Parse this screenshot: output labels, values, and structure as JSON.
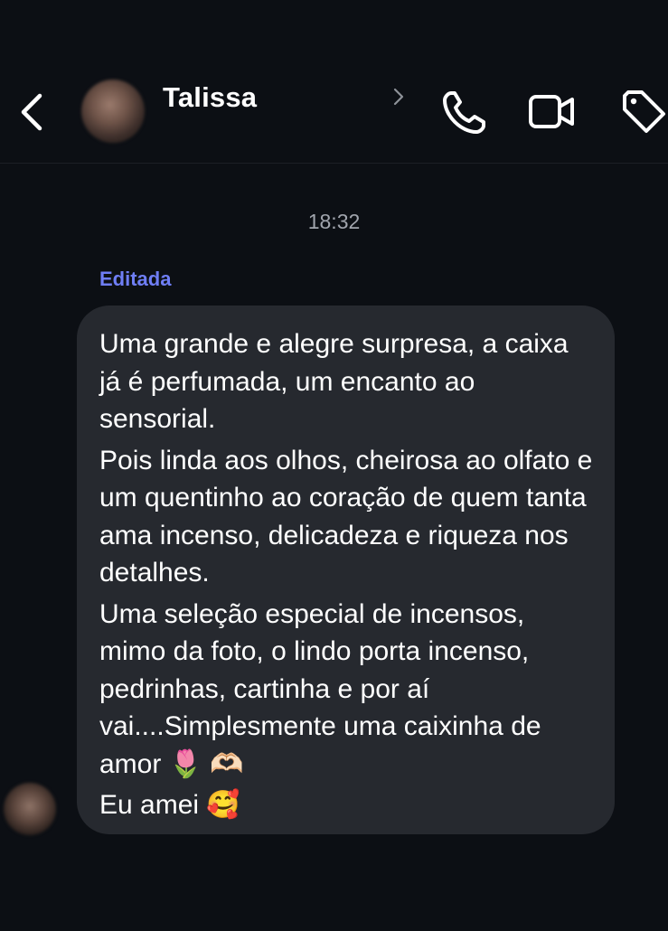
{
  "header": {
    "contact_name": "Talissa",
    "icons": {
      "back": "chevron-left-icon",
      "details": "chevron-right-icon",
      "call": "phone-icon",
      "video": "video-camera-icon",
      "label": "tag-icon"
    }
  },
  "chat": {
    "timestamp": "18:32",
    "edited_label": "Editada",
    "message": {
      "paragraphs": [
        "Uma grande e alegre surpresa, a caixa já é perfumada, um encanto ao sensorial.",
        "Pois linda aos olhos, cheirosa ao olfato e um quentinho ao coração de quem tanta ama incenso, delicadeza e riqueza nos detalhes.",
        "Uma seleção especial de incensos, mimo da foto, o lindo porta incenso, pedrinhas, cartinha e por aí vai....Simplesmente uma caixinha de amor 🌷 🫶🏻",
        "Eu amei 🥰"
      ]
    }
  },
  "colors": {
    "background": "#0c0f14",
    "bubble": "#26292f",
    "edited_accent": "#6f7ef5",
    "timestamp": "#a1a5ad"
  }
}
